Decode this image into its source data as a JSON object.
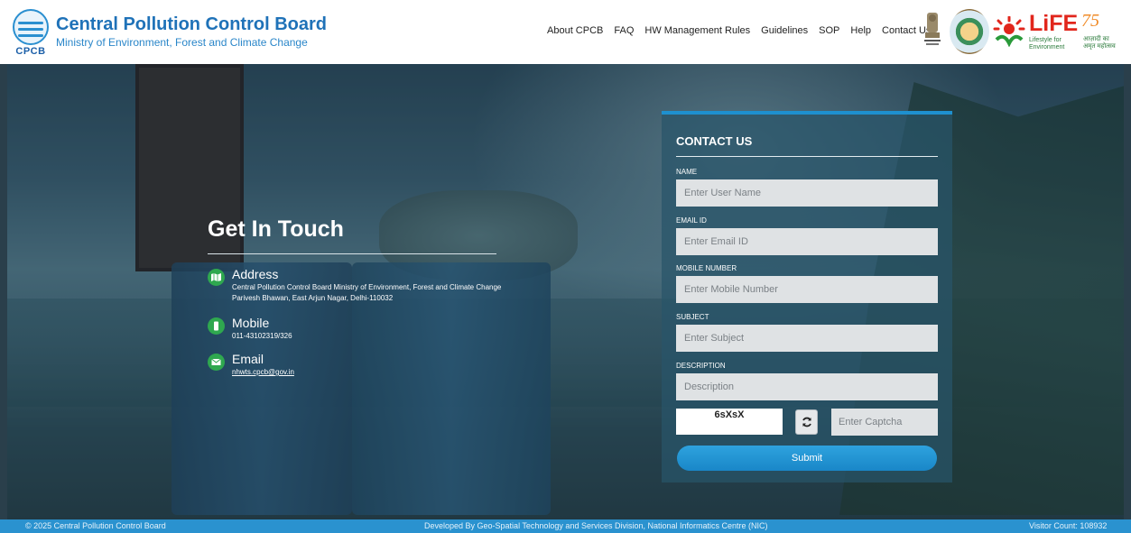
{
  "header": {
    "logo_text": "CPCB",
    "title": "Central Pollution Control Board",
    "subtitle": "Ministry of Environment, Forest and Climate Change",
    "nav": [
      "About CPCB",
      "FAQ",
      "HW Management Rules",
      "Guidelines",
      "SOP",
      "Help",
      "Contact Us"
    ],
    "life_logo": {
      "title": "LiFE",
      "sub1": "Lifestyle for",
      "sub2": "Environment"
    },
    "azadi_logo": {
      "number": "75",
      "text": "आज़ादी का अमृत महोत्सव"
    }
  },
  "touch": {
    "title": "Get In Touch",
    "items": [
      {
        "heading": "Address",
        "text": "Central Pollution Control Board Ministry of Environment, Forest and Climate Change Parivesh Bhawan, East Arjun Nagar, Delhi-110032",
        "icon": "map-icon"
      },
      {
        "heading": "Mobile",
        "text": "011-43102319/326",
        "icon": "mobile-icon"
      },
      {
        "heading": "Email",
        "text": "nhwts.cpcb@gov.in",
        "icon": "envelope-icon"
      }
    ]
  },
  "form": {
    "title": "CONTACT US",
    "fields": [
      {
        "label": "NAME",
        "placeholder": "Enter User Name"
      },
      {
        "label": "EMAIL ID",
        "placeholder": "Enter Email ID"
      },
      {
        "label": "MOBILE NUMBER",
        "placeholder": "Enter Mobile Number"
      },
      {
        "label": "SUBJECT",
        "placeholder": "Enter Subject"
      },
      {
        "label": "DESCRIPTION",
        "placeholder": "Description"
      }
    ],
    "captcha_code": "6sXsX",
    "captcha_placeholder": "Enter Captcha",
    "submit_label": "Submit"
  },
  "footer": {
    "copyright": "© 2025 Central Pollution Control Board",
    "developer": "Developed By Geo-Spatial Technology and Services Division, National Informatics Centre (NIC)",
    "visitor": "Visitor Count:  108932"
  },
  "colors": {
    "brand": "#1f72b8",
    "footer": "#2a92cf",
    "submit": "#1e90cf",
    "icon_green": "#2fa84f"
  }
}
